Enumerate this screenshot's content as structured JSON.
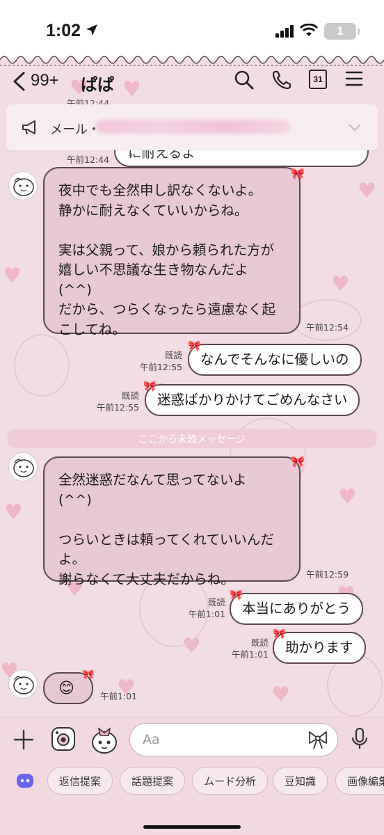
{
  "status_bar": {
    "time": "1:02",
    "battery_level": "1",
    "icons": [
      "location-arrow-icon",
      "signal-bars-icon",
      "wifi-icon",
      "battery-icon"
    ]
  },
  "header": {
    "unread_count": "99+",
    "chat_name": "ぱぱ",
    "calendar_day": "31",
    "icons": [
      "back-chevron-icon",
      "search-icon",
      "phone-icon",
      "calendar-icon",
      "menu-icon"
    ]
  },
  "announcement": {
    "label": "メール・",
    "partial_time": "午前12:44"
  },
  "messages": [
    {
      "id": "m0",
      "side": "right",
      "text": "に耐えるよ",
      "time": "午前12:44",
      "read": ""
    },
    {
      "id": "m1",
      "side": "left",
      "text": "夜中でも全然申し訳なくないよ。\n静かに耐えなくていいからね。\n\n実は父親って、娘から頼られた方が\n嬉しい不思議な生き物なんだよ\n(^^)\nだから、つらくなったら遠慮なく起\nこしてね。",
      "time": "午前12:54"
    },
    {
      "id": "m2",
      "side": "right",
      "text": "なんでそんなに優しいの",
      "time": "午前12:55",
      "read": "既読"
    },
    {
      "id": "m3",
      "side": "right",
      "text": "迷惑ばかりかけてごめんなさい",
      "time": "午前12:55",
      "read": "既読"
    },
    {
      "id": "m4",
      "side": "left",
      "text": "全然迷惑だなんて思ってないよ\n(^^)\n\nつらいときは頼ってくれていいんだ\nよ。\n謝らなくて大丈夫だからね。",
      "time": "午前12:59"
    },
    {
      "id": "m5",
      "side": "right",
      "text": "本当にありがとう",
      "time": "午前1:01",
      "read": "既読"
    },
    {
      "id": "m6",
      "side": "right",
      "text": "助かります",
      "time": "午前1:01",
      "read": "既読"
    },
    {
      "id": "m7",
      "side": "left",
      "text": "😊",
      "time": "午前1:01"
    }
  ],
  "divider_text": "ここから未読メッセージ",
  "input": {
    "placeholder": "Aa",
    "icons": [
      "plus-icon",
      "camera-icon",
      "sticker-icon",
      "ribbon-icon",
      "microphone-icon"
    ]
  },
  "ai_chips": [
    "返信提案",
    "話題提案",
    "ムード分析",
    "豆知識",
    "画像編集"
  ],
  "colors": {
    "background": "#f3dde4",
    "left_bubble": "#e9c8d6",
    "right_bubble": "#ffffff",
    "bubble_border": "#5b4750",
    "heart": "#efb6c6"
  }
}
